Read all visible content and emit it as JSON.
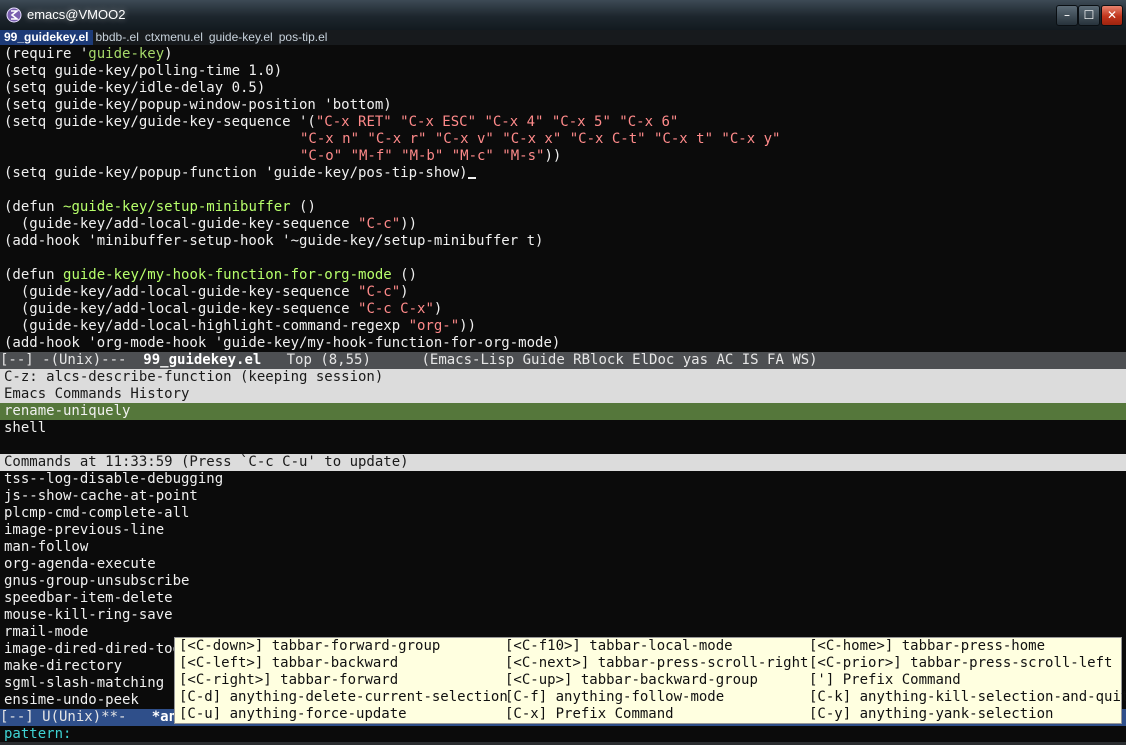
{
  "window": {
    "title": "emacs@VMOO2",
    "buttons": {
      "minimize": "–",
      "maximize": "☐",
      "close": "✕"
    }
  },
  "tabs": [
    "99_guidekey.el",
    "bbdb-.el",
    "ctxmenu.el",
    "guide-key.el",
    "pos-tip.el"
  ],
  "code": {
    "l1_a": "(require '",
    "l1_b": "guide-key",
    "l1_c": ")",
    "l2": "(setq guide-key/polling-time 1.0)",
    "l3": "(setq guide-key/idle-delay 0.5)",
    "l4": "(setq guide-key/popup-window-position 'bottom)",
    "l5_a": "(setq guide-key/guide-key-sequence '(",
    "l5_b": "\"C-x RET\" \"C-x ESC\" \"C-x 4\" \"C-x 5\" \"C-x 6\"",
    "l6": "\"C-x n\" \"C-x r\" \"C-x v\" \"C-x x\" \"C-x C-t\" \"C-x t\" \"C-x y\"",
    "l7_a": "\"C-o\" \"M-f\" \"M-b\" \"M-c\" \"M-s\"",
    "l7_b": "))",
    "l8": "(setq guide-key/popup-function 'guide-key/pos-tip-show)",
    "l10_a": "(defun ",
    "l10_b": "~guide-key/setup-minibuffer",
    "l10_c": " ()",
    "l11_a": "  (guide-key/add-local-guide-key-sequence ",
    "l11_b": "\"C-c\"",
    "l11_c": "))",
    "l12": "(add-hook 'minibuffer-setup-hook '~guide-key/setup-minibuffer t)",
    "l14_a": "(defun ",
    "l14_b": "guide-key/my-hook-function-for-org-mode",
    "l14_c": " ()",
    "l15_a": "  (guide-key/add-local-guide-key-sequence ",
    "l15_b": "\"C-c\"",
    "l15_c": ")",
    "l16_a": "  (guide-key/add-local-guide-key-sequence ",
    "l16_b": "\"C-c C-x\"",
    "l16_c": ")",
    "l17_a": "  (guide-key/add-local-highlight-command-regexp ",
    "l17_b": "\"org-\"",
    "l17_c": "))",
    "l18": "(add-hook 'org-mode-hook 'guide-key/my-hook-function-for-org-mode)"
  },
  "modeline_top": {
    "pre": "[--] -(Unix)---  ",
    "buffer": "99_guidekey.el",
    "post": "   Top (8,55)      (Emacs-Lisp Guide RBlock ElDoc yas AC IS FA WS)"
  },
  "anything": {
    "header1": "C-z: alcs-describe-function (keeping session)",
    "source1": "Emacs Commands History",
    "history": [
      "rename-uniquely",
      "shell"
    ],
    "header2": "Commands at 11:33:59 (Press `C-c C-u' to update)",
    "commands": [
      "tss--log-disable-debugging",
      "js--show-cache-at-point",
      "plcmp-cmd-complete-all",
      "image-previous-line",
      "man-follow",
      "org-agenda-execute",
      "gnus-group-unsubscribe",
      "speedbar-item-delete",
      "mouse-kill-ring-save",
      "rmail-mode",
      "image-dired-dired-tog",
      "make-directory",
      "sgml-slash-matching",
      "ensime-undo-peek"
    ]
  },
  "modeline_bottom": {
    "pre": "[--] U(Unix)**-   ",
    "buffer": "*any"
  },
  "minibuffer": {
    "prompt": "pattern:"
  },
  "popup": {
    "rows": [
      [
        {
          "key": "[<C-down>]",
          "cmd": "tabbar-forward-group"
        },
        {
          "key": "[<C-f10>]",
          "cmd": "tabbar-local-mode"
        },
        {
          "key": "[<C-home>]",
          "cmd": "tabbar-press-home"
        }
      ],
      [
        {
          "key": "[<C-left>]",
          "cmd": "tabbar-backward"
        },
        {
          "key": "[<C-next>]",
          "cmd": "tabbar-press-scroll-right"
        },
        {
          "key": "[<C-prior>]",
          "cmd": "tabbar-press-scroll-left"
        }
      ],
      [
        {
          "key": "[<C-right>]",
          "cmd": "tabbar-forward"
        },
        {
          "key": "[<C-up>]",
          "cmd": "tabbar-backward-group"
        },
        {
          "key": "[']",
          "cmd": "Prefix Command"
        }
      ],
      [
        {
          "key": "[C-d]",
          "cmd": "anything-delete-current-selection"
        },
        {
          "key": "[C-f]",
          "cmd": "anything-follow-mode"
        },
        {
          "key": "[C-k]",
          "cmd": "anything-kill-selection-and-quit"
        }
      ],
      [
        {
          "key": "[C-u]",
          "cmd": "anything-force-update"
        },
        {
          "key": "[C-x]",
          "cmd": "Prefix Command"
        },
        {
          "key": "[C-y]",
          "cmd": "anything-yank-selection"
        }
      ]
    ]
  }
}
